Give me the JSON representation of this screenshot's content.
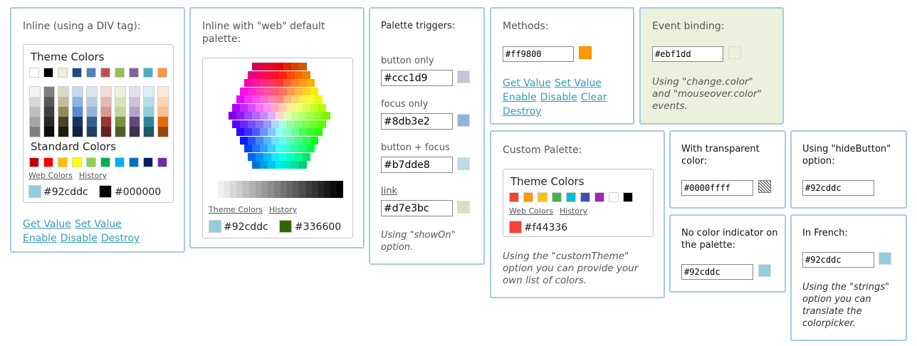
{
  "panel_inline": {
    "title": "Inline (using a DIV tag):",
    "theme_heading": "Theme Colors",
    "standard_heading": "Standard Colors",
    "web_colors_link": "Web Colors",
    "history_link": "History",
    "current_value": "#92cddc",
    "current_color": "#92cddc",
    "previous_value": "#000000",
    "previous_color": "#000000",
    "theme_top": [
      "#ffffff",
      "#000000",
      "#eeece1",
      "#1f497d",
      "#4f81bd",
      "#c0504d",
      "#9bbb59",
      "#8064a2",
      "#4bacc6",
      "#f79646"
    ],
    "theme_columns": [
      [
        "#f2f2f2",
        "#d8d8d8",
        "#bfbfbf",
        "#a5a5a5",
        "#7f7f7f"
      ],
      [
        "#7f7f7f",
        "#595959",
        "#3f3f3f",
        "#262626",
        "#0c0c0c"
      ],
      [
        "#ddd9c3",
        "#c4bd97",
        "#938953",
        "#494429",
        "#1d1b10"
      ],
      [
        "#c6d9f0",
        "#8db3e2",
        "#548dd4",
        "#17365d",
        "#0f243e"
      ],
      [
        "#dbe5f1",
        "#b8cce4",
        "#95b3d7",
        "#366092",
        "#244061"
      ],
      [
        "#f2dcdb",
        "#e5b9b7",
        "#d99694",
        "#953734",
        "#632423"
      ],
      [
        "#ebf1dd",
        "#d7e3bc",
        "#c3d69b",
        "#76923c",
        "#4f6128"
      ],
      [
        "#e5e0ec",
        "#ccc1d9",
        "#b2a2c7",
        "#5f497a",
        "#3f3151"
      ],
      [
        "#dbeef3",
        "#b7dde8",
        "#92cddc",
        "#31859b",
        "#205867"
      ],
      [
        "#fdeada",
        "#fbd5b5",
        "#fac08f",
        "#e36c09",
        "#974806"
      ]
    ],
    "standard": [
      "#c00000",
      "#ff0000",
      "#ffc000",
      "#ffff00",
      "#92d050",
      "#00b050",
      "#00b0f0",
      "#0070c0",
      "#002060",
      "#7030a0"
    ],
    "links": [
      "Get Value",
      "Set Value",
      "Enable",
      "Disable",
      "Destroy"
    ]
  },
  "panel_web": {
    "title": "Inline with \"web\" default palette:",
    "theme_link": "Theme Colors",
    "history_link": "History",
    "current_value": "#92cddc",
    "current_color": "#92cddc",
    "previous_value": "#336600",
    "previous_color": "#336600",
    "grays": [
      "#ffffff",
      "#f2f2f2",
      "#e6e6e6",
      "#d9d9d9",
      "#cccccc",
      "#bfbfbf",
      "#b2b2b2",
      "#a6a6a6",
      "#999999",
      "#8c8c8c",
      "#808080",
      "#737373",
      "#666666",
      "#595959",
      "#4d4d4d",
      "#404040",
      "#333333",
      "#262626",
      "#1a1a1a",
      "#0d0d0d",
      "#000000"
    ]
  },
  "panel_triggers": {
    "title": "Palette triggers:",
    "items": [
      {
        "label": "button only",
        "value": "#ccc1d9",
        "color": "#ccc1d9"
      },
      {
        "label": "focus only",
        "value": "#8db3e2",
        "color": "#8db3e2"
      },
      {
        "label": "button + focus",
        "value": "#b7dde8",
        "color": "#b7dde8"
      },
      {
        "label": "link",
        "value": "#d7e3bc",
        "color": "#d7e3bc"
      }
    ],
    "note": "Using \"showOn\" option."
  },
  "panel_methods": {
    "title": "Methods:",
    "value": "#ff9800",
    "color": "#ff9800",
    "links": [
      "Get Value",
      "Set Value",
      "Enable",
      "Disable",
      "Clear",
      "Destroy"
    ]
  },
  "panel_events": {
    "title": "Event binding:",
    "value": "#ebf1dd",
    "color": "#ebf1dd",
    "note": "Using \"change.color\" and \"mouseover.color\" events."
  },
  "panel_custom": {
    "title": "Custom Palette:",
    "theme_heading": "Theme Colors",
    "colors": [
      "#f44336",
      "#ff9800",
      "#ffc107",
      "#4caf50",
      "#00bcd4",
      "#3f51b5",
      "#9c27b0",
      "#ffffff",
      "#000000"
    ],
    "web_colors_link": "Web Colors",
    "history_link": "History",
    "current_value": "#f44336",
    "current_color": "#f44336",
    "note": "Using the \"customTheme\" option you can provide your own list of colors."
  },
  "panel_transparent": {
    "title": "With transparent color:",
    "value": "#0000ffff"
  },
  "panel_hidebutton": {
    "title": "Using \"hideButton\" option:",
    "value": "#92cddc"
  },
  "panel_noindicator": {
    "title": "No color indicator on the palette:",
    "value": "#92cddc",
    "color": "#92cddc"
  },
  "panel_french": {
    "title": "In French:",
    "value": "#92cddc",
    "color": "#92cddc",
    "note": "Using the \"strings\" option you can translate the colorpicker."
  }
}
